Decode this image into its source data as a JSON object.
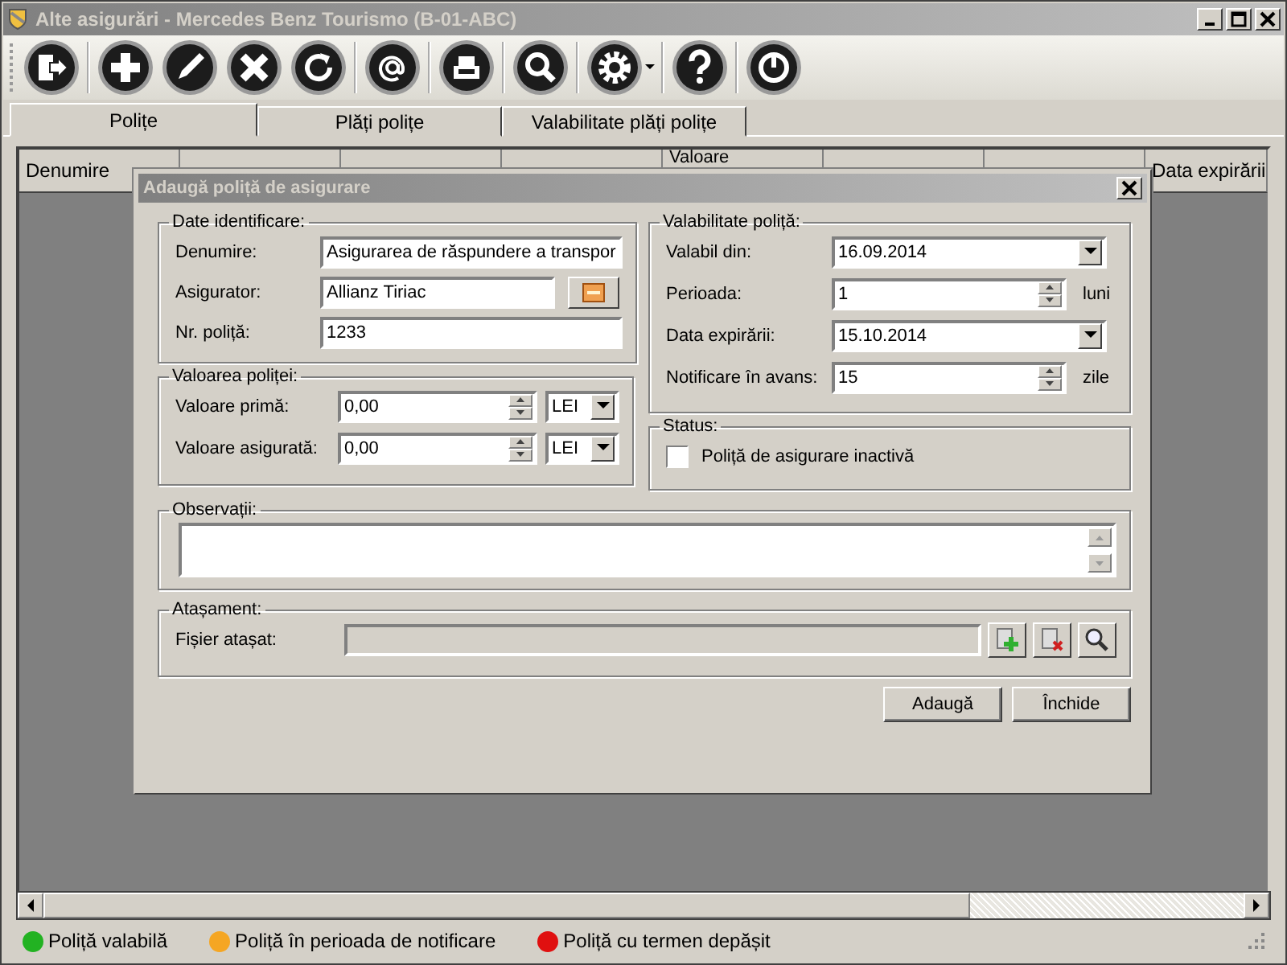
{
  "window": {
    "title": "Alte asigurări - Mercedes Benz Tourismo (B-01-ABC)"
  },
  "toolbar": {
    "groups": [
      {
        "buttons": [
          {
            "kind": "exit"
          }
        ]
      },
      {
        "buttons": [
          {
            "kind": "add"
          },
          {
            "kind": "edit"
          },
          {
            "kind": "delete"
          },
          {
            "kind": "refresh"
          }
        ]
      },
      {
        "buttons": [
          {
            "kind": "email"
          }
        ]
      },
      {
        "buttons": [
          {
            "kind": "print"
          }
        ]
      },
      {
        "buttons": [
          {
            "kind": "search"
          }
        ]
      },
      {
        "buttons": [
          {
            "kind": "settings"
          }
        ]
      },
      {
        "buttons": [
          {
            "kind": "help"
          }
        ]
      },
      {
        "buttons": [
          {
            "kind": "power"
          }
        ]
      }
    ]
  },
  "tabs": [
    {
      "label": "Polițe",
      "selected": true
    },
    {
      "label": "Plăți polițe",
      "selected": false
    },
    {
      "label": "Valabilitate plăți polițe",
      "selected": false
    }
  ],
  "table": {
    "columns": [
      {
        "label": "Denumire",
        "hidden": false
      },
      {
        "hidden": true
      },
      {
        "hidden": true
      },
      {
        "hidden": true
      },
      {
        "label": "Valoare",
        "hidden": false
      },
      {
        "hidden": true
      },
      {
        "hidden": true
      },
      {
        "label": "Data expirării",
        "hidden": false
      }
    ]
  },
  "dialog": {
    "title": "Adaugă poliță de asigurare",
    "identification": {
      "title": "Date identificare:",
      "fields": [
        {
          "label": "Denumire:",
          "value": "Asigurarea de răspundere a transpor",
          "kind": "text"
        },
        {
          "label": "Asigurator:",
          "value": "Allianz Tiriac",
          "kind": "lookup"
        },
        {
          "label": "Nr. poliță:",
          "value": "1233",
          "kind": "text"
        }
      ]
    },
    "amounts": {
      "title": "Valoarea poliței:",
      "fields": [
        {
          "label": "Valoare primă:",
          "value": "0,00",
          "currency": "LEI"
        },
        {
          "label": "Valoare asigurată:",
          "value": "0,00",
          "currency": "LEI"
        }
      ]
    },
    "validity": {
      "title": "Valabilitate poliță:",
      "fields": [
        {
          "label": "Valabil din:",
          "value": "16.09.2014",
          "kind": "date"
        },
        {
          "label": "Perioada:",
          "value": "1",
          "kind": "spin",
          "unit": "luni"
        },
        {
          "label": "Data expirării:",
          "value": "15.10.2014",
          "kind": "date"
        },
        {
          "label": "Notificare în avans:",
          "value": "15",
          "kind": "spin",
          "unit": "zile"
        }
      ]
    },
    "status": {
      "title": "Status:",
      "checkbox": {
        "label": "Poliță de asigurare inactivă",
        "checked": false
      }
    },
    "notes": {
      "title": "Observații:"
    },
    "attachment": {
      "title": "Atașament:",
      "label": "Fișier atașat:"
    },
    "buttons": [
      "Adaugă",
      "Închide"
    ]
  },
  "legend": [
    {
      "label": "Poliță valabilă",
      "color": "#22b222"
    },
    {
      "label": "Poliță în perioada de notificare",
      "color": "#f5a623"
    },
    {
      "label": "Poliță cu termen depășit",
      "color": "#e01010"
    }
  ]
}
